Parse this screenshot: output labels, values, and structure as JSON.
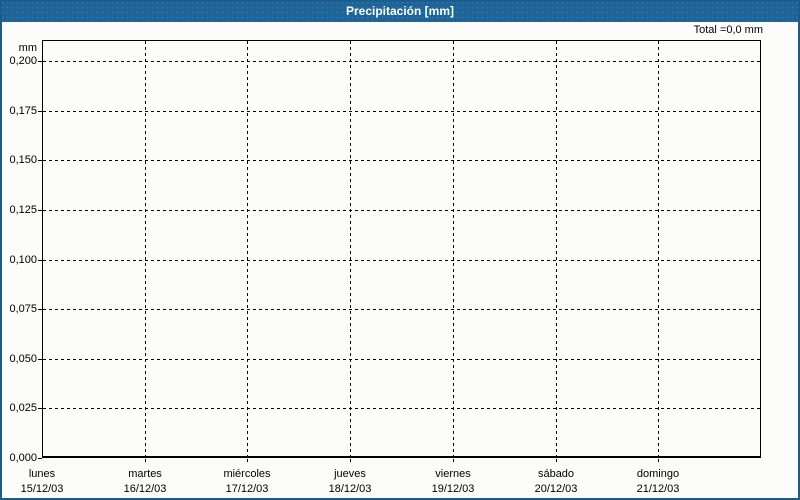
{
  "window": {
    "title": "Precipitación [mm]"
  },
  "summary": {
    "total_label": "Total =0,0 mm"
  },
  "y_axis": {
    "unit": "mm",
    "tick_labels": [
      "0,200",
      "0,175",
      "0,150",
      "0,125",
      "0,100",
      "0,075",
      "0,050",
      "0,025",
      "0,000"
    ]
  },
  "x_axis": {
    "days": [
      {
        "name": "lunes",
        "date": "15/12/03"
      },
      {
        "name": "martes",
        "date": "16/12/03"
      },
      {
        "name": "miércoles",
        "date": "17/12/03"
      },
      {
        "name": "jueves",
        "date": "18/12/03"
      },
      {
        "name": "viernes",
        "date": "19/12/03"
      },
      {
        "name": "sábado",
        "date": "20/12/03"
      },
      {
        "name": "domingo",
        "date": "21/12/03"
      }
    ]
  },
  "colors": {
    "titlebar_bg": "#1d6498",
    "titlebar_text": "#ffffff",
    "frame_border": "#1a5d8c",
    "plot_border": "#000000",
    "grid": "#000000",
    "background": "#fcfdfa"
  },
  "chart_data": {
    "type": "bar",
    "title": "Precipitación [mm]",
    "ylabel": "mm",
    "ylim": [
      0,
      0.2
    ],
    "y_tick_step": 0.025,
    "y_ticks": [
      0.0,
      0.025,
      0.05,
      0.075,
      0.1,
      0.125,
      0.15,
      0.175,
      0.2
    ],
    "decimal_separator": ",",
    "categories": [
      "lunes 15/12/03",
      "martes 16/12/03",
      "miércoles 17/12/03",
      "jueves 18/12/03",
      "viernes 19/12/03",
      "sábado 20/12/03",
      "domingo 21/12/03"
    ],
    "values": [
      0,
      0,
      0,
      0,
      0,
      0,
      0
    ],
    "total": 0.0,
    "total_label": "Total =0,0 mm",
    "grid": "dashed",
    "legend_position": "none"
  }
}
